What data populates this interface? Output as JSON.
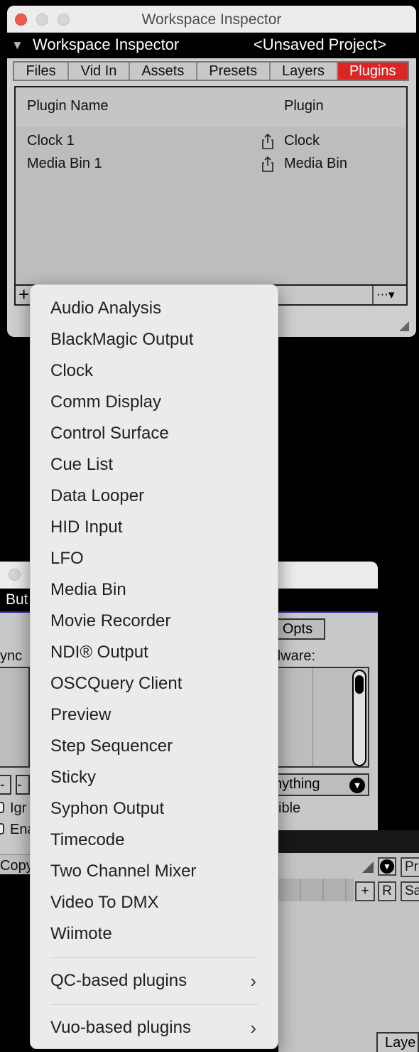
{
  "top_window": {
    "title": "Workspace Inspector",
    "inspector_bar": {
      "title": "Workspace Inspector",
      "project": "<Unsaved Project>"
    },
    "tabs": [
      {
        "label": "Files"
      },
      {
        "label": "Vid In"
      },
      {
        "label": "Assets"
      },
      {
        "label": "Presets"
      },
      {
        "label": "Layers"
      },
      {
        "label": "Plugins",
        "active": true
      }
    ],
    "table": {
      "columns": [
        "Plugin Name",
        "Plugin"
      ],
      "rows": [
        {
          "name": "Clock 1",
          "plugin": "Clock"
        },
        {
          "name": "Media Bin 1",
          "plugin": "Media Bin"
        }
      ]
    },
    "bottom_bar": {
      "add_label": "+",
      "options_label": "⋯▾"
    }
  },
  "back_window": {
    "title_fragment": "But",
    "opts_label": "Opts",
    "sync_fragment": "ync",
    "hardware_fragment": "dware:",
    "select_value_fragment": "nything",
    "visible_fragment": "sible",
    "ignore_fragment": "Igr",
    "enable_fragment": "Ena",
    "copy_fragment": "Copy",
    "minus_label": "-"
  },
  "bottom_right": {
    "pr_fragment": "Pr",
    "sa_fragment": "Sa",
    "plus_label": "+",
    "r_label": "R",
    "layer_fragment": "Laye"
  },
  "popup_menu": {
    "items": [
      "Audio Analysis",
      "BlackMagic Output",
      "Clock",
      "Comm Display",
      "Control Surface",
      "Cue List",
      "Data Looper",
      "HID Input",
      "LFO",
      "Media Bin",
      "Movie Recorder",
      "NDI® Output",
      "OSCQuery Client",
      "Preview",
      "Step Sequencer",
      "Sticky",
      "Syphon Output",
      "Timecode",
      "Two Channel Mixer",
      "Video To DMX",
      "Wiimote"
    ],
    "submenus": [
      "QC-based plugins",
      "Vuo-based plugins"
    ]
  },
  "colors": {
    "active_tab": "#dc2626",
    "close_button": "#ee5a52",
    "menu_background": "#ebebeb"
  }
}
